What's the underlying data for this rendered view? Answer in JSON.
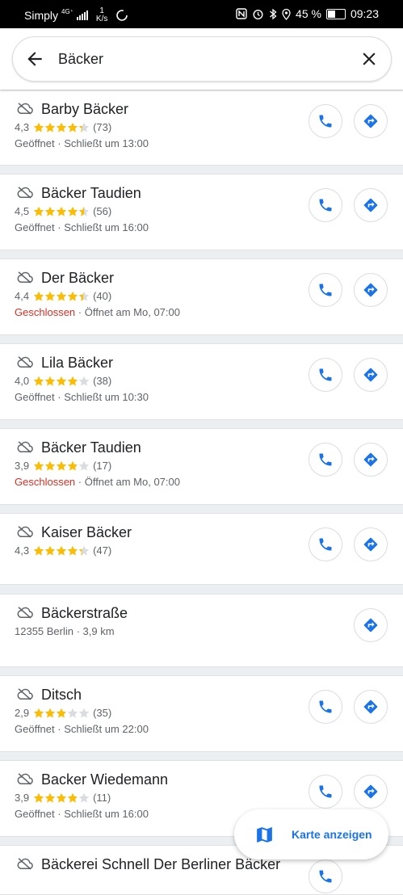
{
  "status_bar": {
    "carrier": "Simply",
    "network_type": "4G⁺",
    "speed_value": "1",
    "speed_unit": "K/s",
    "battery": "45 %",
    "time": "09:23"
  },
  "search": {
    "query": "Bäcker"
  },
  "results": [
    {
      "name": "Barby Bäcker",
      "rating": "4,3",
      "stars": 4.3,
      "reviews": "(73)",
      "status": "Geöffnet",
      "status_closed": false,
      "hours": " · Schließt um 13:00",
      "has_phone": true
    },
    {
      "name": "Bäcker Taudien",
      "rating": "4,5",
      "stars": 4.5,
      "reviews": "(56)",
      "status": "Geöffnet",
      "status_closed": false,
      "hours": " · Schließt um 16:00",
      "has_phone": true
    },
    {
      "name": "Der Bäcker",
      "rating": "4,4",
      "stars": 4.4,
      "reviews": "(40)",
      "status": "Geschlossen",
      "status_closed": true,
      "hours": " · Öffnet am Mo, 07:00",
      "has_phone": true
    },
    {
      "name": "Lila Bäcker",
      "rating": "4,0",
      "stars": 4.0,
      "reviews": "(38)",
      "status": "Geöffnet",
      "status_closed": false,
      "hours": " · Schließt um 10:30",
      "has_phone": true
    },
    {
      "name": "Bäcker Taudien",
      "rating": "3,9",
      "stars": 3.9,
      "reviews": "(17)",
      "status": "Geschlossen",
      "status_closed": true,
      "hours": " · Öffnet am Mo, 07:00",
      "has_phone": true
    },
    {
      "name": "Kaiser Bäcker",
      "rating": "4,3",
      "stars": 4.3,
      "reviews": "(47)",
      "status": "",
      "status_closed": false,
      "hours": "",
      "has_phone": true
    },
    {
      "name": "Bäckerstraße",
      "address": "12355 Berlin · 3,9 km",
      "has_phone": false
    },
    {
      "name": "Ditsch",
      "rating": "2,9",
      "stars": 2.9,
      "reviews": "(35)",
      "status": "Geöffnet",
      "status_closed": false,
      "hours": " · Schließt um 22:00",
      "has_phone": true
    },
    {
      "name": "Backer Wiedemann",
      "rating": "3,9",
      "stars": 3.9,
      "reviews": "(11)",
      "status": "Geöffnet",
      "status_closed": false,
      "hours": " · Schließt um 16:00",
      "has_phone": true
    },
    {
      "name": "Bäckerei Schnell Der Berliner Bäcker",
      "has_phone": true
    }
  ],
  "map_button": {
    "label": "Karte anzeigen"
  },
  "colors": {
    "accent": "#1a73e8",
    "star": "#fbbc04",
    "closed": "#d93025"
  },
  "icons": [
    "back-arrow-icon",
    "clear-icon",
    "offline-cloud-icon",
    "phone-icon",
    "directions-icon",
    "map-icon",
    "star-icon"
  ]
}
